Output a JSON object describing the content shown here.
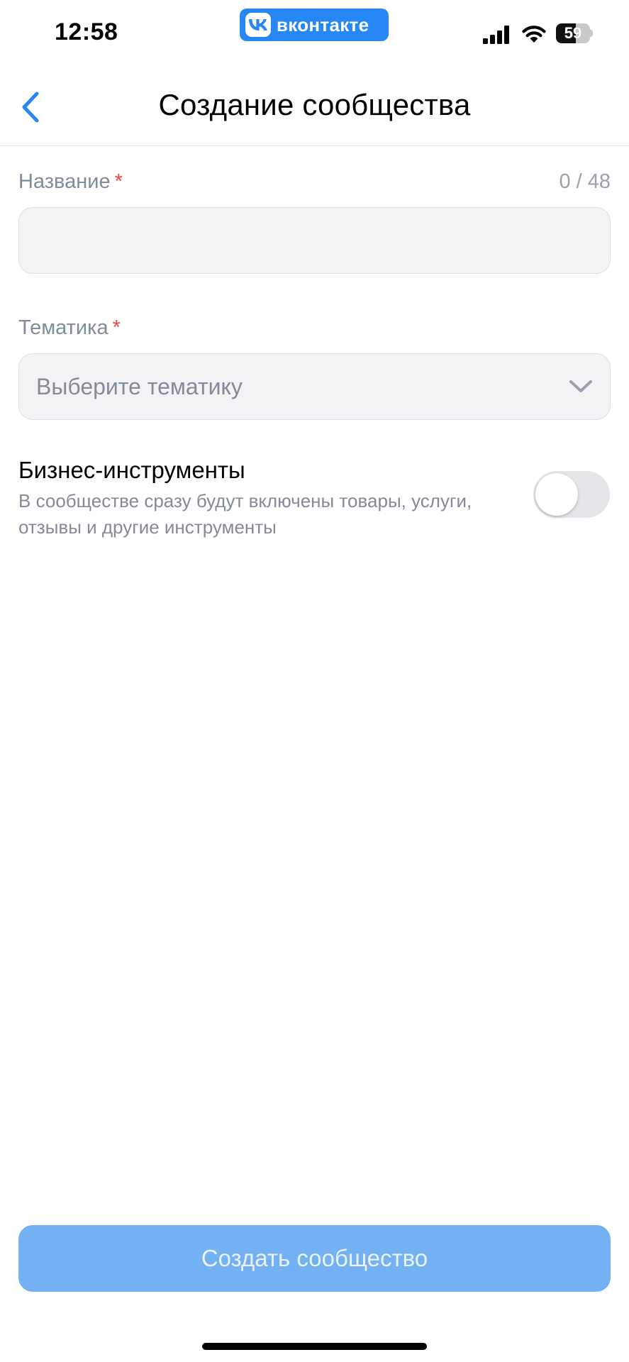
{
  "status_bar": {
    "time": "12:58",
    "app_badge": "вконтакте",
    "battery_percent": 59,
    "battery_label": "59",
    "icons": [
      "signal-icon",
      "wifi-icon",
      "battery-icon"
    ]
  },
  "header": {
    "title": "Создание сообщества",
    "back_icon": "chevron-left-icon"
  },
  "form": {
    "name": {
      "label": "Название",
      "required_mark": "*",
      "counter": "0 / 48",
      "value": "",
      "placeholder": ""
    },
    "topic": {
      "label": "Тематика",
      "required_mark": "*",
      "placeholder": "Выберите тематику",
      "icon": "chevron-down-icon"
    },
    "business_tools": {
      "title": "Бизнес-инструменты",
      "description": "В сообществе сразу будут включены товары, услуги, отзывы и другие инструменты",
      "enabled": false
    }
  },
  "footer": {
    "create_label": "Создать сообщество"
  },
  "colors": {
    "accent": "#2787f5",
    "button_disabled": "#73b1f2",
    "required": "#e64646",
    "secondary_text": "#818c99",
    "field_bg": "#f2f3f5"
  }
}
